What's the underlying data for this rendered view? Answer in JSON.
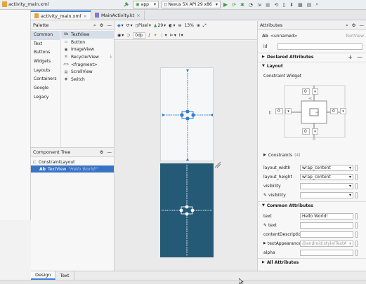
{
  "window": {
    "file_tab": "activity_main.xml",
    "run_config": "app",
    "device": "Nexus 5X API 29 x86"
  },
  "editor_tabs": [
    {
      "label": "activity_main.xml",
      "active": true
    },
    {
      "label": "MainActivity.kt",
      "active": false
    }
  ],
  "palette": {
    "title": "Palette",
    "categories": [
      "Common",
      "Text",
      "Buttons",
      "Widgets",
      "Layouts",
      "Containers",
      "Google",
      "Legacy"
    ],
    "selected_category": "Common",
    "items": [
      {
        "icon": "Ab",
        "label": "TextView"
      },
      {
        "icon": "▭",
        "label": "Button"
      },
      {
        "icon": "▣",
        "label": "ImageView"
      },
      {
        "icon": "≡",
        "label": "RecyclerView"
      },
      {
        "icon": "<>",
        "label": "<fragment>"
      },
      {
        "icon": "▤",
        "label": "ScrollView"
      },
      {
        "icon": "◉",
        "label": "Switch"
      }
    ]
  },
  "component_tree": {
    "title": "Component Tree",
    "nodes": [
      {
        "label": "ConstraintLayout",
        "hint": ""
      },
      {
        "label": "TextView",
        "hint": "\"Hello World!\""
      }
    ]
  },
  "canvas": {
    "dp_label": "0dp",
    "device_label": "Pixel",
    "api_label": "29",
    "zoom": "13%"
  },
  "attributes": {
    "title": "Attributes",
    "component_type": "<unnamed>",
    "component_class": "TextView",
    "id_label": "id",
    "id_value": "",
    "declared_attributes": "Declared Attributes",
    "layout_section": "Layout",
    "constraint_widget": "Constraint Widget",
    "margins": {
      "top": "0",
      "left": "0",
      "right": "0",
      "bottom": "0"
    },
    "constraints_label": "Constraints",
    "constraints_count": "(4)",
    "rows": [
      {
        "label": "layout_width",
        "value": "wrap_content"
      },
      {
        "label": "layout_height",
        "value": "wrap_content"
      },
      {
        "label": "visibility",
        "value": ""
      },
      {
        "label": "visibility",
        "value": ""
      }
    ],
    "common_attributes": "Common Attributes",
    "common_rows": [
      {
        "label": "text",
        "value": "Hello World!"
      },
      {
        "label": "text",
        "value": ""
      },
      {
        "label": "contentDescription",
        "value": ""
      },
      {
        "label": "textAppearance",
        "value": "@android:style/TextA"
      },
      {
        "label": "alpha",
        "value": ""
      }
    ],
    "all_attributes": "All Attributes"
  },
  "bottom_tabs": [
    "Design",
    "Text"
  ],
  "colors": {
    "accent": "#3d82d8",
    "selection": "#3873c4",
    "blueprint": "#255a76",
    "constraint_blue": "#2f7dd6",
    "run_green": "#3f9b3f"
  }
}
